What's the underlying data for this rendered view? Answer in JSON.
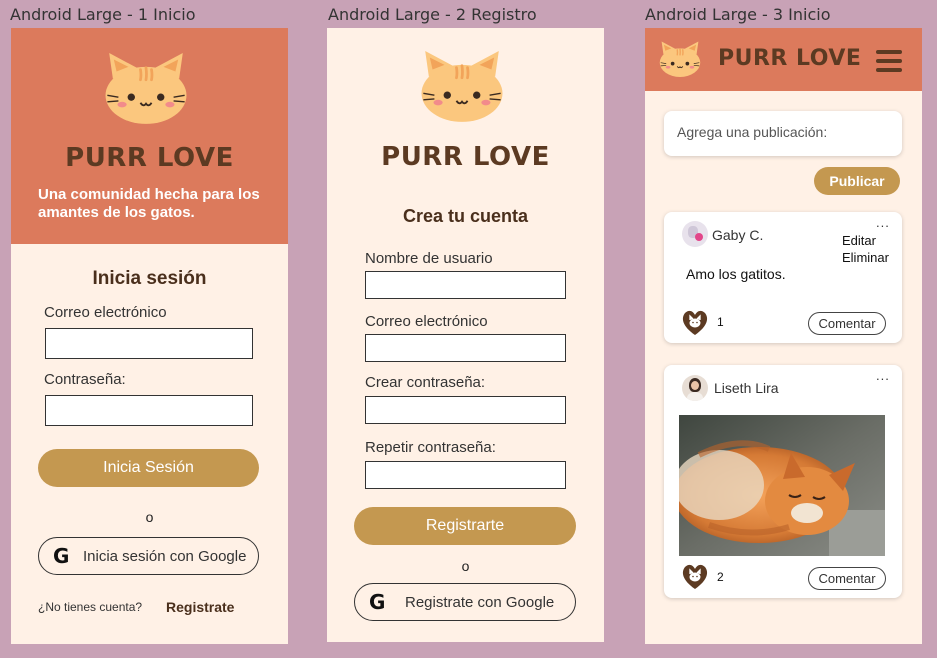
{
  "frames": {
    "login_label": "Android Large - 1  Inicio",
    "register_label": "Android Large - 2 Registro",
    "home_label": "Android Large - 3 Inicio"
  },
  "login": {
    "brand": "PURR LOVE",
    "tagline": "Una comunidad hecha para los amantes de los gatos.",
    "heading": "Inicia sesión",
    "email_label": "Correo electrónico",
    "password_label": "Contraseña:",
    "submit": "Inicia Sesión",
    "or": "o",
    "google_button": "Inicia sesión con Google",
    "no_account": "¿No tienes cuenta?",
    "register_link": "Registrate"
  },
  "register": {
    "brand": "PURR LOVE",
    "heading": "Crea tu cuenta",
    "username_label": "Nombre de usuario",
    "email_label": "Correo electrónico",
    "password_label": "Crear contraseña:",
    "repeat_label": "Repetir contraseña:",
    "submit": "Registrarte",
    "or": "o",
    "google_button": "Registrate con Google"
  },
  "home": {
    "brand": "PURR LOVE",
    "post_placeholder": "Agrega una publicación:",
    "publish": "Publicar",
    "posts": [
      {
        "author": "Gaby C.",
        "text": "Amo los gatitos.",
        "likes": "1",
        "comment": "Comentar",
        "menu": "...",
        "edit": "Editar",
        "delete": "Eliminar"
      },
      {
        "author": "Liseth Lira",
        "likes": "2",
        "comment": "Comentar",
        "menu": "..."
      }
    ]
  },
  "colors": {
    "background": "#c8a2b6",
    "header": "#dc7a5c",
    "cream": "#fff1e6",
    "gold": "#c49850",
    "brown": "#5c3a22",
    "cat": "#fbc77e"
  }
}
